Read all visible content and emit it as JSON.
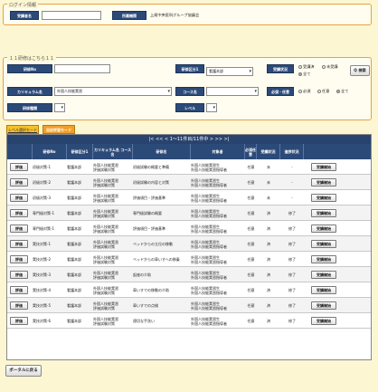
{
  "login": {
    "legend": "ログイン情報",
    "user_label": "受講者名",
    "user_value": "",
    "org_label": "所属機関",
    "org_value": "上尾中央医科グループ協議会"
  },
  "search": {
    "legend": "１１研修はこちら１１",
    "subject_no_label": "研修No",
    "subject_no_value": "",
    "category1_label": "研修区分1",
    "category1_value": "看護本部",
    "status_label": "受講状況",
    "status_options": [
      "受講済",
      "未受講",
      "全て"
    ],
    "status_selected": "全て",
    "search_button": "Q 検索",
    "curriculum_label": "カリキュラム名",
    "curriculum_value": "外国人技能実習",
    "course_label": "コース名",
    "course_value": "",
    "required_label": "必須・任意",
    "required_options": [
      "必須",
      "任意",
      "全て"
    ],
    "required_selected": "全て",
    "subject_type_label": "研修種類",
    "subject_type_value": "",
    "level_label": "レベル",
    "level_value": ""
  },
  "tabs": {
    "level": "レベル選択モード",
    "free": "自由学習モード"
  },
  "pager": {
    "text": "|<  <<  <  1～11件目/11件中  >  >>  >|"
  },
  "table": {
    "headers": {
      "subject_no": "研修No",
      "category1": "研修区分1",
      "curriculum": "カリキュラム名 コース名",
      "subject_name": "研修名",
      "target": "対象者",
      "required": "必須任意",
      "status": "受講状況",
      "progress": "進捗状況"
    },
    "eval_label": "評価",
    "start_label": "受講開始",
    "rows": [
      {
        "no": "初級対策-1",
        "cat": "看護本部",
        "curr1": "外国人技能実習",
        "curr2": "評価試験対策",
        "name": "初級試験の概要と準備",
        "target1": "外国人技能実習生",
        "target2": "外国人技能実習指導者",
        "req": "任意",
        "status": "未",
        "progress": "-"
      },
      {
        "no": "初級対策-2",
        "cat": "看護本部",
        "curr1": "外国人技能実習",
        "curr2": "評価試験対策",
        "name": "初級試験の内容と対策",
        "target1": "外国人技能実習生",
        "target2": "外国人技能実習指導者",
        "req": "任意",
        "status": "未",
        "progress": "-"
      },
      {
        "no": "初級対策-3",
        "cat": "看護本部",
        "curr1": "外国人技能実習",
        "curr2": "評価試験対策",
        "name": "評価項目・評価基準",
        "target1": "外国人技能実習生",
        "target2": "外国人技能実習指導者",
        "req": "任意",
        "status": "未",
        "progress": "-"
      },
      {
        "no": "専門級対策-1",
        "cat": "看護本部",
        "curr1": "外国人技能実習",
        "curr2": "評価試験対策",
        "name": "専門級試験の概要",
        "target1": "外国人技能実習生",
        "target2": "外国人技能実習指導者",
        "req": "任意",
        "status": "済",
        "progress": "修了"
      },
      {
        "no": "専門級対策-1",
        "cat": "看護本部",
        "curr1": "外国人技能実習",
        "curr2": "評価試験対策",
        "name": "評価項目・評価基準",
        "target1": "外国人技能実習生",
        "target2": "外国人技能実習指導者",
        "req": "任意",
        "status": "済",
        "progress": "修了"
      },
      {
        "no": "実技対策-1",
        "cat": "看護本部",
        "curr1": "外国人技能実習",
        "curr2": "評価試験対策",
        "name": "ベッドからの立位の移動",
        "target1": "外国人技能実習生",
        "target2": "外国人技能実習指導者",
        "req": "任意",
        "status": "済",
        "progress": "修了"
      },
      {
        "no": "実技対策-2",
        "cat": "看護本部",
        "curr1": "外国人技能実習",
        "curr2": "評価試験対策",
        "name": "ベッドからの車いすへの移乗",
        "target1": "外国人技能実習生",
        "target2": "外国人技能実習指導者",
        "req": "任意",
        "status": "済",
        "progress": "修了"
      },
      {
        "no": "実技対策-3",
        "cat": "看護本部",
        "curr1": "外国人技能実習",
        "curr2": "評価試験対策",
        "name": "起座の介助",
        "target1": "外国人技能実習生",
        "target2": "外国人技能実習指導者",
        "req": "任意",
        "status": "済",
        "progress": "修了"
      },
      {
        "no": "実技対策-4",
        "cat": "看護本部",
        "curr1": "外国人技能実習",
        "curr2": "評価試験対策",
        "name": "車いすでの移動の介助",
        "target1": "外国人技能実習生",
        "target2": "外国人技能実習指導者",
        "req": "任意",
        "status": "済",
        "progress": "修了"
      },
      {
        "no": "実技対策-5",
        "cat": "看護本部",
        "curr1": "外国人技能実習",
        "curr2": "評価試験対策",
        "name": "車いすでの点検",
        "target1": "外国人技能実習生",
        "target2": "外国人技能実習指導者",
        "req": "任意",
        "status": "済",
        "progress": "修了"
      },
      {
        "no": "実技対策-6",
        "cat": "看護本部",
        "curr1": "外国人技能実習",
        "curr2": "評価試験対策",
        "name": "適切な手洗い",
        "target1": "外国人技能実習生",
        "target2": "外国人技能実習指導者",
        "req": "任意",
        "status": "済",
        "progress": "修了"
      }
    ]
  },
  "footer": {
    "portal_button": "ポータルに戻る"
  }
}
